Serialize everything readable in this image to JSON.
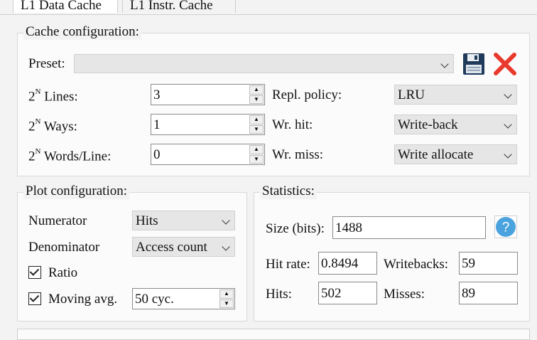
{
  "tabs": [
    {
      "label": "L1 Data Cache",
      "active": true
    },
    {
      "label": "L1 Instr. Cache",
      "active": false
    }
  ],
  "cache_config": {
    "title": "Cache configuration:",
    "preset_label": "Preset:",
    "preset_value": "",
    "lines": {
      "label_base": "2",
      "label_sup": "N",
      "label_text": " Lines:",
      "value": "3"
    },
    "ways": {
      "label_base": "2",
      "label_sup": "N",
      "label_text": " Ways:",
      "value": "1"
    },
    "words": {
      "label_base": "2",
      "label_sup": "N",
      "label_text": " Words/Line:",
      "value": "0"
    },
    "repl_policy": {
      "label": "Repl. policy:",
      "value": "LRU"
    },
    "wr_hit": {
      "label": "Wr. hit:",
      "value": "Write-back"
    },
    "wr_miss": {
      "label": "Wr. miss:",
      "value": "Write allocate"
    }
  },
  "plot_config": {
    "title": "Plot configuration:",
    "numerator_label": "Numerator",
    "numerator_value": "Hits",
    "denominator_label": "Denominator",
    "denominator_value": "Access count",
    "ratio_label": "Ratio",
    "moving_avg_label": "Moving avg.",
    "moving_avg_value": "50 cyc."
  },
  "statistics": {
    "title": "Statistics:",
    "size_label": "Size (bits):",
    "size_value": "1488",
    "hit_rate_label": "Hit rate:",
    "hit_rate_value": "0.8494",
    "writebacks_label": "Writebacks:",
    "writebacks_value": "59",
    "hits_label": "Hits:",
    "hits_value": "502",
    "misses_label": "Misses:",
    "misses_value": "89"
  },
  "icons": {
    "save": "floppy-disk-icon",
    "delete": "red-x-icon",
    "help": "question-mark-icon"
  },
  "colors": {
    "delete_red": "#e8392c",
    "help_blue": "#4aa3df",
    "floppy_navy": "#1f3a5a"
  }
}
